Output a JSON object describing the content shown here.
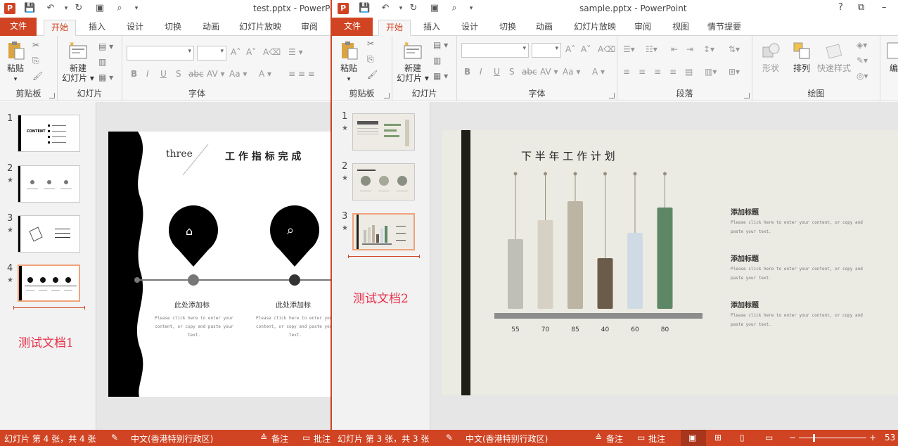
{
  "window1": {
    "title": "test.pptx - PowerPoint",
    "tabs": [
      "文件",
      "开始",
      "插入",
      "设计",
      "切换",
      "动画",
      "幻灯片放映",
      "审阅"
    ],
    "groups": {
      "clipboard": "剪贴板",
      "slides": "幻灯片",
      "font": "字体"
    },
    "buttons": {
      "paste": "粘贴",
      "new_slide_1": "新建",
      "new_slide_2": "幻灯片 ▾"
    },
    "font_tools": [
      "B",
      "I",
      "U",
      "S",
      "abc",
      "AV ▾",
      "Aa ▾",
      "A ▾"
    ],
    "slides": [
      {
        "num": "1"
      },
      {
        "num": "2"
      },
      {
        "num": "3"
      },
      {
        "num": "4"
      }
    ],
    "label": "测试文档1",
    "slide": {
      "word": "three",
      "title": "工 作 指 标 完 成",
      "item_titles": [
        "此处添加标",
        "此处添加标"
      ],
      "item_body": "Please click here to enter your content, or copy and paste your text."
    },
    "status": {
      "slide_info": "幻灯片 第 4 张，共 4 张",
      "lang": "中文(香港特别行政区)",
      "notes": "备注",
      "comments": "批注"
    }
  },
  "window2": {
    "title": "sample.pptx - PowerPoint",
    "controls": [
      "?",
      "⧉",
      "–"
    ],
    "tabs": [
      "文件",
      "开始",
      "插入",
      "设计",
      "切换",
      "动画",
      "幻灯片放映",
      "审阅",
      "视图",
      "情节提要"
    ],
    "groups": {
      "clipboard": "剪贴板",
      "slides": "幻灯片",
      "font": "字体",
      "paragraph": "段落",
      "drawing": "绘图"
    },
    "buttons": {
      "paste": "粘贴",
      "new_slide_1": "新建",
      "new_slide_2": "幻灯片 ▾",
      "shapes": "形状",
      "arrange": "排列",
      "quick_styles": "快速样式",
      "edit": "编"
    },
    "slides": [
      {
        "num": "1"
      },
      {
        "num": "2"
      },
      {
        "num": "3"
      }
    ],
    "label": "测试文档2",
    "slide": {
      "title": "下 半 年 工 作 计 划",
      "side_items": [
        {
          "title": "添加标题",
          "body": "Please click here to enter your content, or copy and paste your text."
        },
        {
          "title": "添加标题",
          "body": "Please click here to enter your content, or copy and paste your text."
        },
        {
          "title": "添加标题",
          "body": "Please click here to enter your content, or copy and paste your text."
        }
      ]
    },
    "status": {
      "slide_info": "幻灯片 第 3 张，共 3 张",
      "lang": "中文(香港特别行政区)",
      "notes": "备注",
      "comments": "批注",
      "zoom": "53"
    }
  },
  "chart_data": {
    "type": "bar",
    "title": "下 半 年 工 作 计 划",
    "categories": [
      "",
      "",
      "",
      "",
      "",
      ""
    ],
    "values": [
      55,
      70,
      85,
      40,
      60,
      80
    ],
    "colors": [
      "#bfbfb8",
      "#d6d1c4",
      "#bdb5a3",
      "#6b5b4b",
      "#cfdbe4",
      "#5e8766"
    ],
    "xlabel": "",
    "ylabel": "",
    "ylim": [
      0,
      100
    ]
  }
}
